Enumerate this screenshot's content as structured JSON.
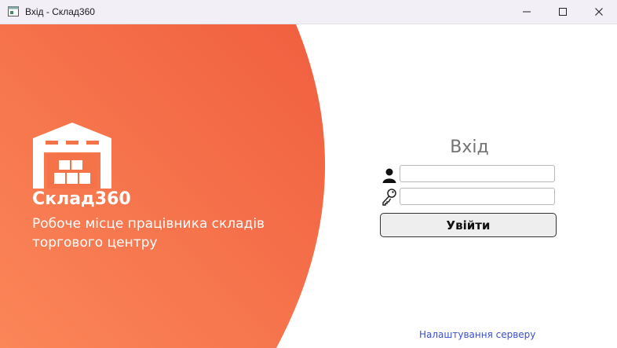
{
  "window": {
    "title": "Вхід - Склад360",
    "controls": [
      "minimize",
      "maximize",
      "close"
    ]
  },
  "branding": {
    "name": "Склад360",
    "tagline": "Робоче місце працівника складів торгового центру",
    "logo_icon": "warehouse-icon",
    "gradient_colors": [
      "#f9845a",
      "#f0603f"
    ]
  },
  "login": {
    "title": "Вхід",
    "username_icon": "user-icon",
    "password_icon": "key-icon",
    "username_value": "",
    "password_value": "",
    "submit_label": "Увійти"
  },
  "footer": {
    "server_settings_link": "Налаштування серверу"
  }
}
